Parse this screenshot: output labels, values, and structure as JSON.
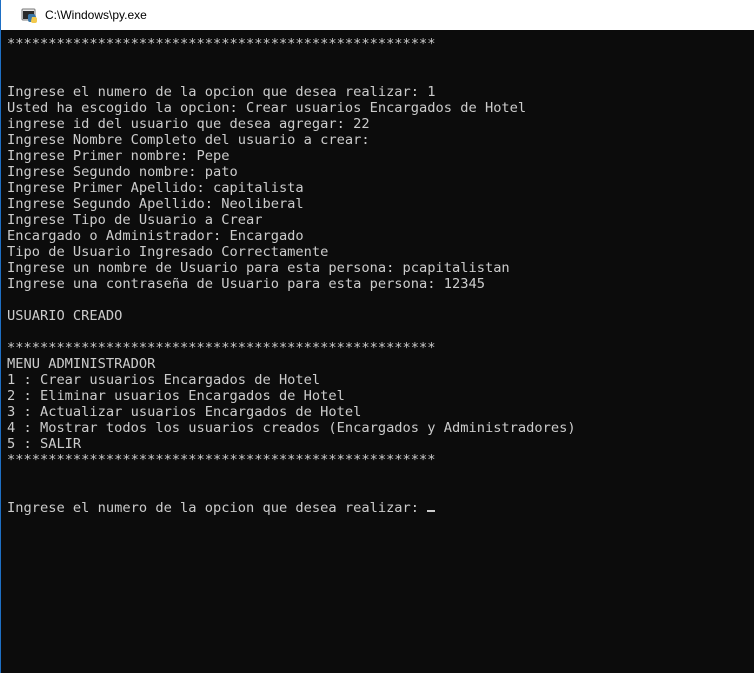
{
  "window": {
    "title": "C:\\Windows\\py.exe",
    "icon": "python-launcher-icon"
  },
  "console": {
    "lines": [
      "****************************************************",
      "",
      "",
      "Ingrese el numero de la opcion que desea realizar: 1",
      "Usted ha escogido la opcion: Crear usuarios Encargados de Hotel",
      "ingrese id del usuario que desea agregar: 22",
      "Ingrese Nombre Completo del usuario a crear:",
      "Ingrese Primer nombre: Pepe",
      "Ingrese Segundo nombre: pato",
      "Ingrese Primer Apellido: capitalista",
      "Ingrese Segundo Apellido: Neoliberal",
      "Ingrese Tipo de Usuario a Crear",
      "Encargado o Administrador: Encargado",
      "Tipo de Usuario Ingresado Correctamente",
      "Ingrese un nombre de Usuario para esta persona: pcapitalistan",
      "Ingrese una contraseña de Usuario para esta persona: 12345",
      "",
      "USUARIO CREADO",
      "",
      "****************************************************",
      "MENU ADMINISTRADOR",
      "1 : Crear usuarios Encargados de Hotel",
      "2 : Eliminar usuarios Encargados de Hotel",
      "3 : Actualizar usuarios Encargados de Hotel",
      "4 : Mostrar todos los usuarios creados (Encargados y Administradores)",
      "5 : SALIR",
      "****************************************************",
      "",
      "",
      "Ingrese el numero de la opcion que desea realizar:"
    ]
  }
}
